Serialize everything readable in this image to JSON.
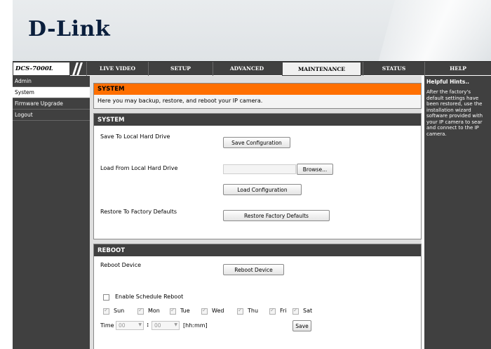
{
  "brand": {
    "logo": "D-Link"
  },
  "nav": {
    "model": "DCS-7000L",
    "tabs": [
      "LIVE VIDEO",
      "SETUP",
      "ADVANCED",
      "MAINTENANCE",
      "STATUS",
      "HELP"
    ],
    "active_tab": "MAINTENANCE"
  },
  "sidebar": {
    "items": [
      {
        "label": "Admin"
      },
      {
        "label": "System"
      },
      {
        "label": "Firmware Upgrade"
      },
      {
        "label": "Logout"
      }
    ],
    "active": "System"
  },
  "intro": {
    "title": "SYSTEM",
    "text": "Here you may backup, restore, and reboot your IP camera."
  },
  "system": {
    "title": "SYSTEM",
    "save_label": "Save To Local Hard Drive",
    "save_button": "Save Configuration",
    "load_label": "Load From Local Hard Drive",
    "browse_button": "Browse...",
    "load_button": "Load Configuration",
    "restore_label": "Restore To Factory Defaults",
    "restore_button": "Restore Factory Defaults"
  },
  "reboot": {
    "title": "REBOOT",
    "device_label": "Reboot Device",
    "device_button": "Reboot Device",
    "schedule_label": "Enable Schedule Reboot",
    "schedule_enabled": false,
    "days": [
      "Sun",
      "Mon",
      "Tue",
      "Wed",
      "Thu",
      "Fri",
      "Sat"
    ],
    "time_label": "Time",
    "hour": "00",
    "minute": "00",
    "separator": ":",
    "time_format": "[hh:mm]",
    "save_button": "Save"
  },
  "hints": {
    "title": "Helpful Hints..",
    "text": "After the factory's\ndefault settings have\nbeen restored, use the\ninstallation wizard\nsoftware provided with\nyour IP camera to sear\nand connect to the IP\ncamera."
  },
  "colors": {
    "accent": "#ff6f00",
    "nav_bg": "#404040",
    "main_bg": "#dfdfdf"
  }
}
